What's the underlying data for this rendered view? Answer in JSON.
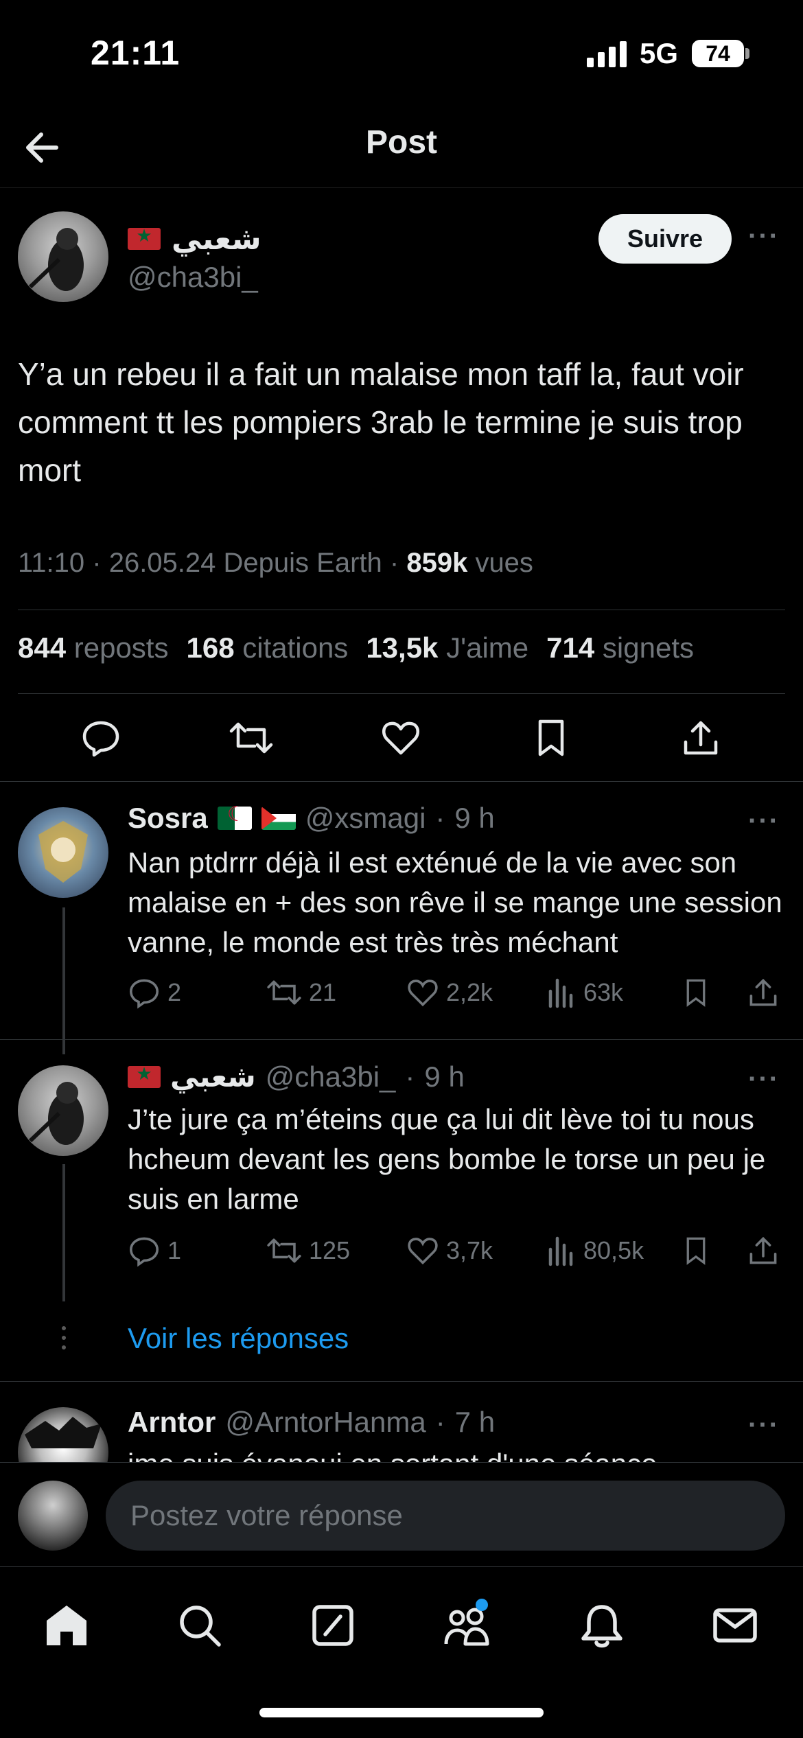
{
  "status_bar": {
    "time": "21:11",
    "network": "5G",
    "battery": "74"
  },
  "header": {
    "title": "Post"
  },
  "post": {
    "author_name": "شعبي",
    "author_handle": "@cha3bi_",
    "follow_label": "Suivre",
    "more": "···",
    "text": "Y’a un rebeu il a fait un malaise  mon taff la, faut voir comment tt les pompiers 3rab le termine je suis trop mort",
    "meta": {
      "time": "11:10",
      "date": "26.05.24",
      "source": "Depuis Earth",
      "views_count": "859k",
      "views_label": "vues"
    },
    "stats": [
      {
        "count": "844",
        "label": "reposts"
      },
      {
        "count": "168",
        "label": "citations"
      },
      {
        "count": "13,5k",
        "label": "J'aime"
      },
      {
        "count": "714",
        "label": "signets"
      }
    ]
  },
  "replies": [
    {
      "name": "Sosra",
      "handle": "@xsmagi",
      "time": "9 h",
      "text": "Nan ptdrrr déjà il est exténué de la vie avec son malaise en + des son rêve il se mange une session vanne, le monde est très très méchant",
      "replies": "2",
      "reposts": "21",
      "likes": "2,2k",
      "views": "63k"
    },
    {
      "name": "شعبي",
      "handle": "@cha3bi_",
      "time": "9 h",
      "text": "J’te jure ça m’éteins que ça lui dit lève toi tu nous hcheum devant les gens bombe le torse un peu je suis en larme",
      "replies": "1",
      "reposts": "125",
      "likes": "3,7k",
      "views": "80,5k"
    },
    {
      "name": "Arntor",
      "handle": "@ArntorHanma",
      "time": "7 h",
      "text": "jme suis évanoui en sortant d'une séance"
    }
  ],
  "show_replies": "Voir les réponses",
  "compose": {
    "placeholder": "Postez votre réponse"
  },
  "colors": {
    "accent": "#1d9bf0",
    "background": "#000000",
    "muted": "#71767b"
  }
}
